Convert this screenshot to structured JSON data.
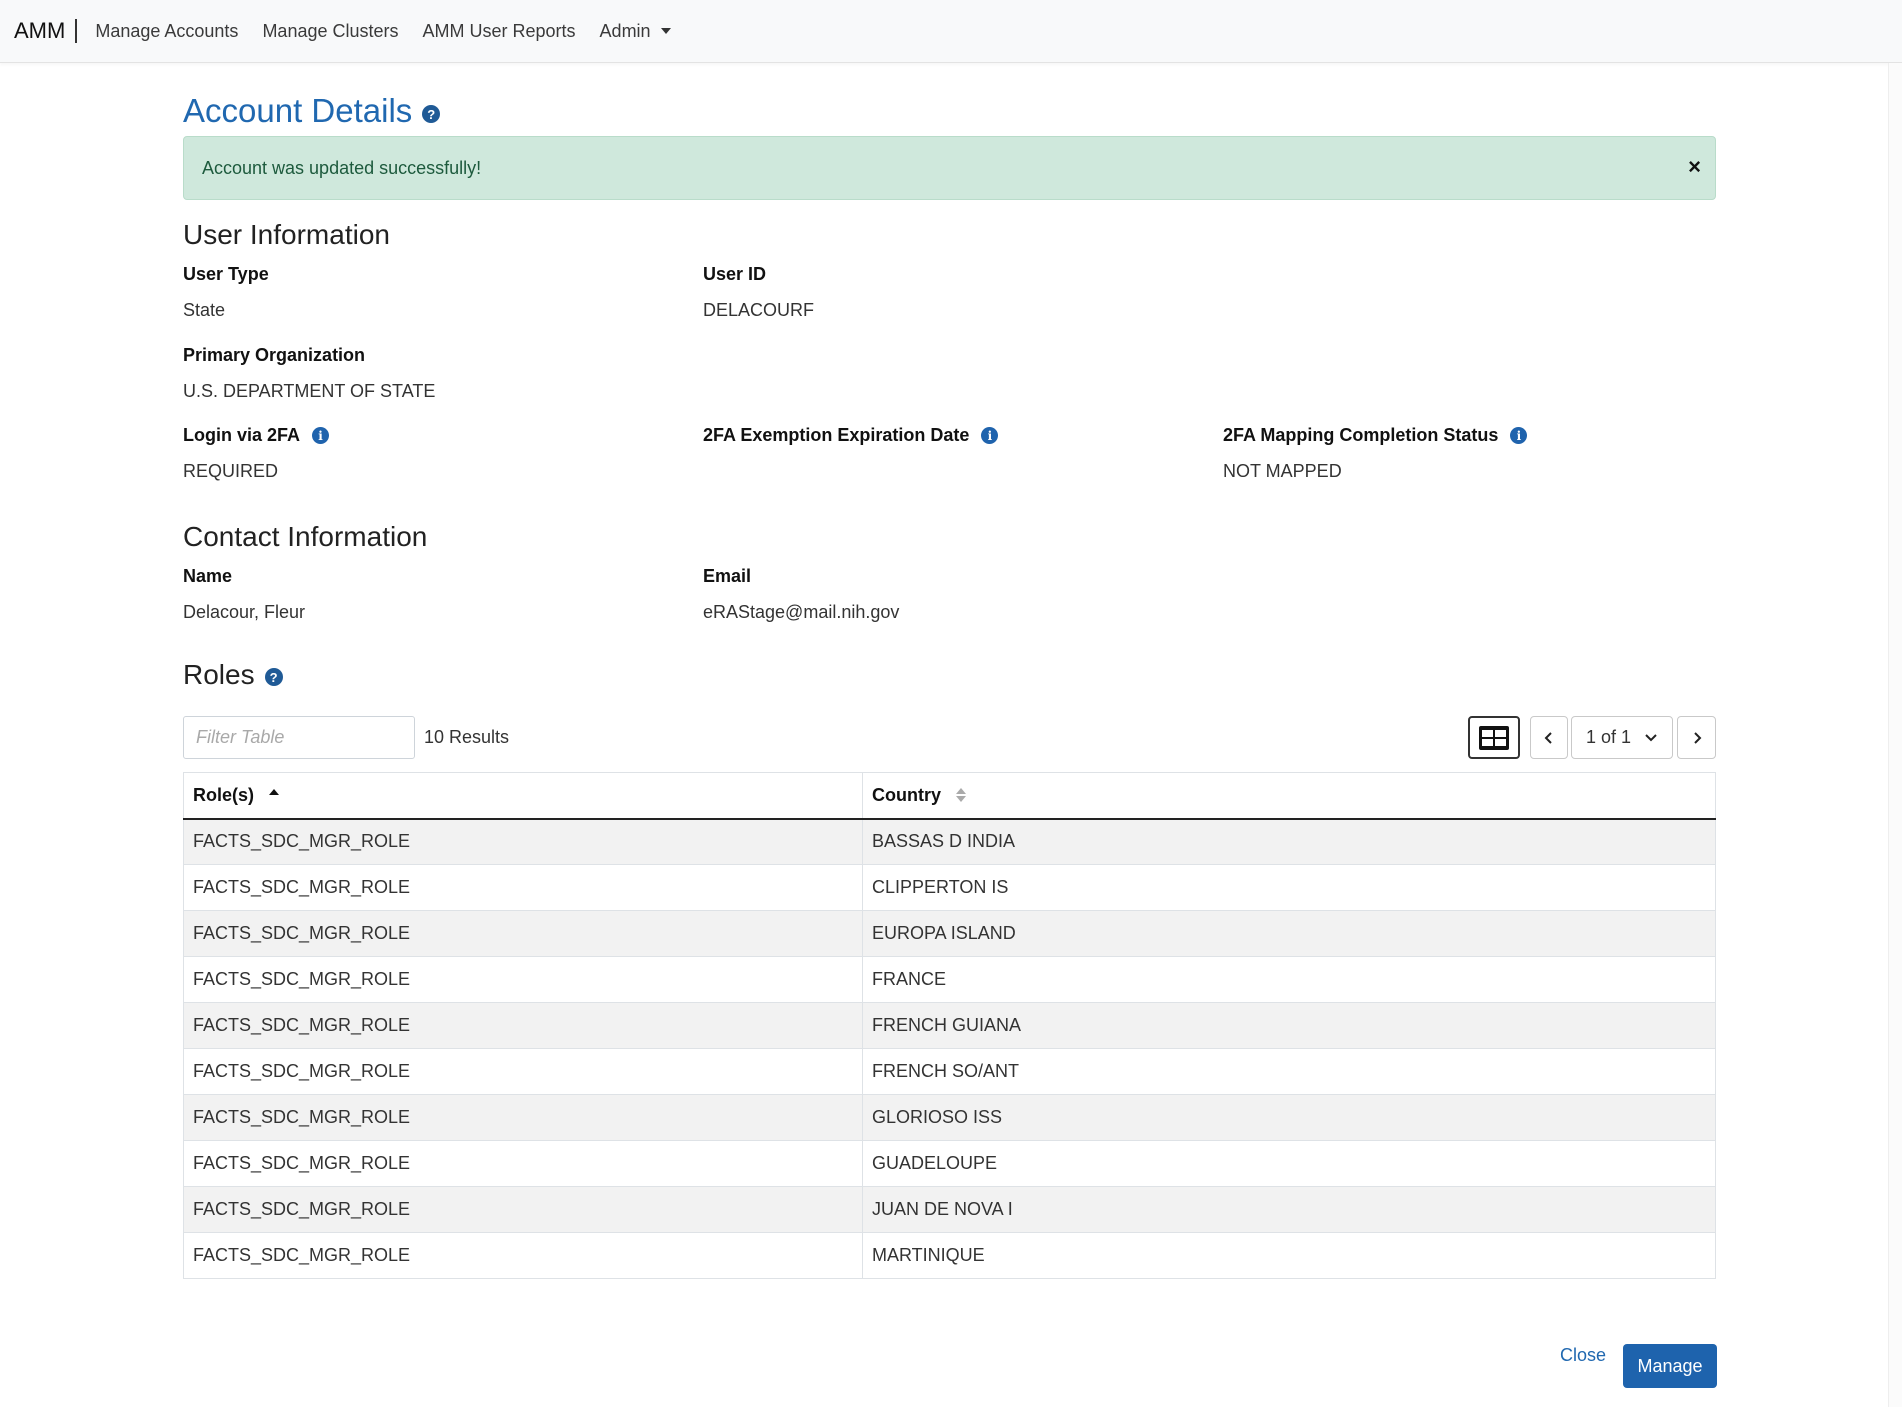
{
  "nav": {
    "brand": "AMM",
    "items": [
      "Manage Accounts",
      "Manage Clusters",
      "AMM User Reports",
      "Admin"
    ]
  },
  "page": {
    "title": "Account Details",
    "help_glyph": "?"
  },
  "alert": {
    "message": "Account was updated successfully!",
    "close_glyph": "×"
  },
  "user_info": {
    "title": "User Information",
    "user_type_label": "User Type",
    "user_type_value": "State",
    "user_id_label": "User ID",
    "user_id_value": "DELACOURF",
    "primary_org_label": "Primary Organization",
    "primary_org_value": "U.S. DEPARTMENT OF STATE",
    "login_2fa_label": "Login via 2FA",
    "login_2fa_value": "REQUIRED",
    "exemption_label": "2FA Exemption Expiration Date",
    "exemption_value": "",
    "mapping_label": "2FA Mapping Completion Status",
    "mapping_value": "NOT MAPPED",
    "info_glyph": "i"
  },
  "contact_info": {
    "title": "Contact Information",
    "name_label": "Name",
    "name_value": "Delacour, Fleur",
    "email_label": "Email",
    "email_value": "eRAStage@mail.nih.gov"
  },
  "roles": {
    "title": "Roles",
    "filter_placeholder": "Filter Table",
    "results": "10 Results",
    "pager_label": "1 of 1",
    "columns": [
      "Role(s)",
      "Country"
    ],
    "rows": [
      [
        "FACTS_SDC_MGR_ROLE",
        "BASSAS D INDIA"
      ],
      [
        "FACTS_SDC_MGR_ROLE",
        "CLIPPERTON IS"
      ],
      [
        "FACTS_SDC_MGR_ROLE",
        "EUROPA ISLAND"
      ],
      [
        "FACTS_SDC_MGR_ROLE",
        "FRANCE"
      ],
      [
        "FACTS_SDC_MGR_ROLE",
        "FRENCH GUIANA"
      ],
      [
        "FACTS_SDC_MGR_ROLE",
        "FRENCH SO/ANT"
      ],
      [
        "FACTS_SDC_MGR_ROLE",
        "GLORIOSO ISS"
      ],
      [
        "FACTS_SDC_MGR_ROLE",
        "GUADELOUPE"
      ],
      [
        "FACTS_SDC_MGR_ROLE",
        "JUAN DE NOVA I"
      ],
      [
        "FACTS_SDC_MGR_ROLE",
        "MARTINIQUE"
      ]
    ]
  },
  "actions": {
    "close_label": "Close",
    "manage_label": "Manage"
  },
  "colors": {
    "accent": "#2068b0",
    "alert_bg": "#cfe8dc",
    "button": "#1e63ad"
  }
}
